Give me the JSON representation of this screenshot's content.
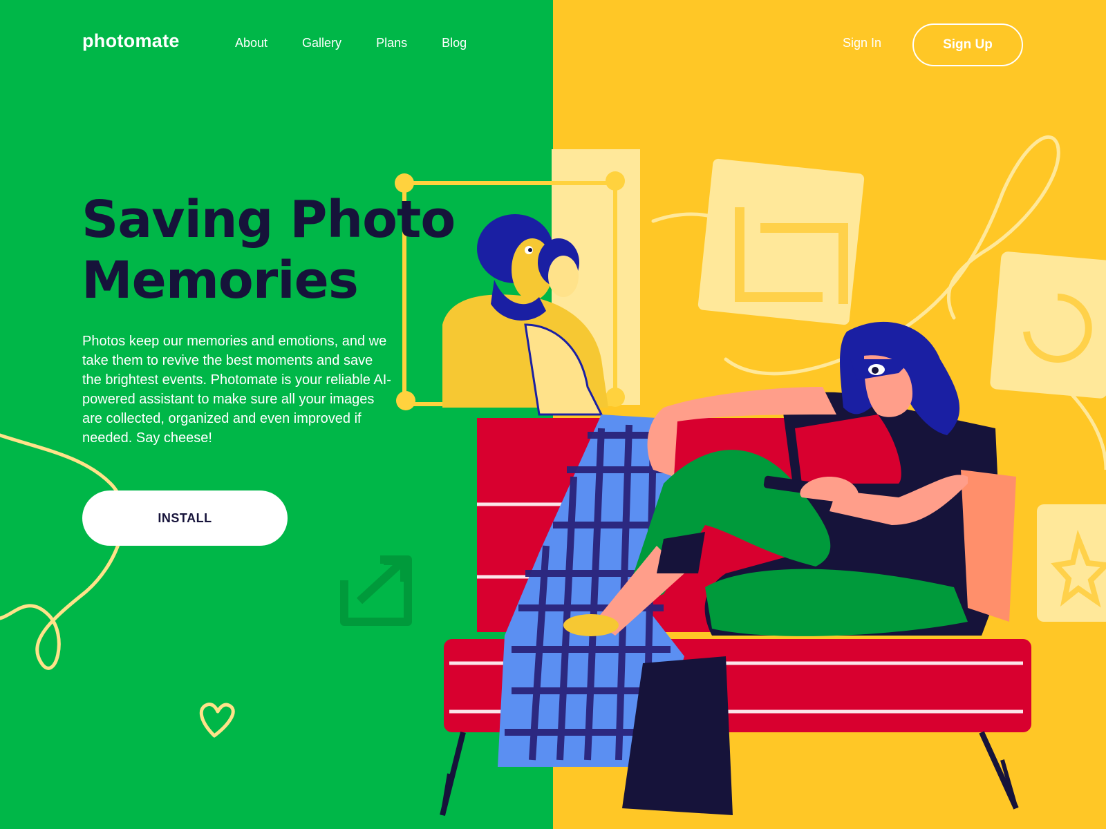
{
  "header": {
    "brand": "photomate",
    "nav": [
      "About",
      "Gallery",
      "Plans",
      "Blog"
    ],
    "sign_in": "Sign In",
    "sign_up": "Sign Up"
  },
  "hero": {
    "title_line1": "Saving Photo",
    "title_line2": "Memories",
    "description": "Photos keep our memories and emotions, and we take them to revive the best moments and save the brightest events. Photomate is your reliable AI-powered assistant to make sure all your images are collected, organized and even improved if needed. Say cheese!",
    "cta": "INSTALL"
  },
  "colors": {
    "left_bg": "#00b748",
    "right_bg": "#ffc726",
    "heading": "#16133a",
    "sofa_red": "#d8002f",
    "plaid_blue": "#5b8ff2",
    "hair_blue": "#1a1fa3"
  },
  "icons": [
    "crop-icon",
    "rotate-icon",
    "star-icon",
    "share-arrow-icon",
    "heart-icon"
  ]
}
